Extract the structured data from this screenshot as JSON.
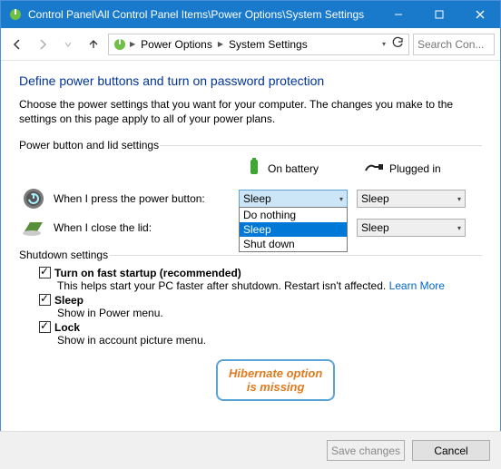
{
  "window": {
    "title": "Control Panel\\All Control Panel Items\\Power Options\\System Settings"
  },
  "breadcrumb": {
    "item1": "Power Options",
    "item2": "System Settings"
  },
  "search": {
    "placeholder": "Search Con..."
  },
  "page": {
    "heading": "Define power buttons and turn on password protection",
    "intro": "Choose the power settings that you want for your computer. The changes you make to the settings on this page apply to all of your power plans."
  },
  "groups": {
    "pb": "Power button and lid settings",
    "sd": "Shutdown settings"
  },
  "columns": {
    "battery": "On battery",
    "plugged": "Plugged in"
  },
  "rows": {
    "power_button": {
      "label": "When I press the power button:",
      "batt": "Sleep",
      "plug": "Sleep"
    },
    "lid": {
      "label": "When I close the lid:",
      "plug": "Sleep"
    }
  },
  "dropdown_options": {
    "o0": "Do nothing",
    "o1": "Sleep",
    "o2": "Shut down"
  },
  "shutdown": {
    "fast": {
      "label": "Turn on fast startup (recommended)",
      "desc": "This helps start your PC faster after shutdown. Restart isn't affected. ",
      "link": "Learn More"
    },
    "sleep": {
      "label": "Sleep",
      "desc": "Show in Power menu."
    },
    "lock": {
      "label": "Lock",
      "desc": "Show in account picture menu."
    }
  },
  "callout": {
    "l1": "Hibernate option",
    "l2": "is missing"
  },
  "buttons": {
    "save": "Save changes",
    "cancel": "Cancel"
  }
}
